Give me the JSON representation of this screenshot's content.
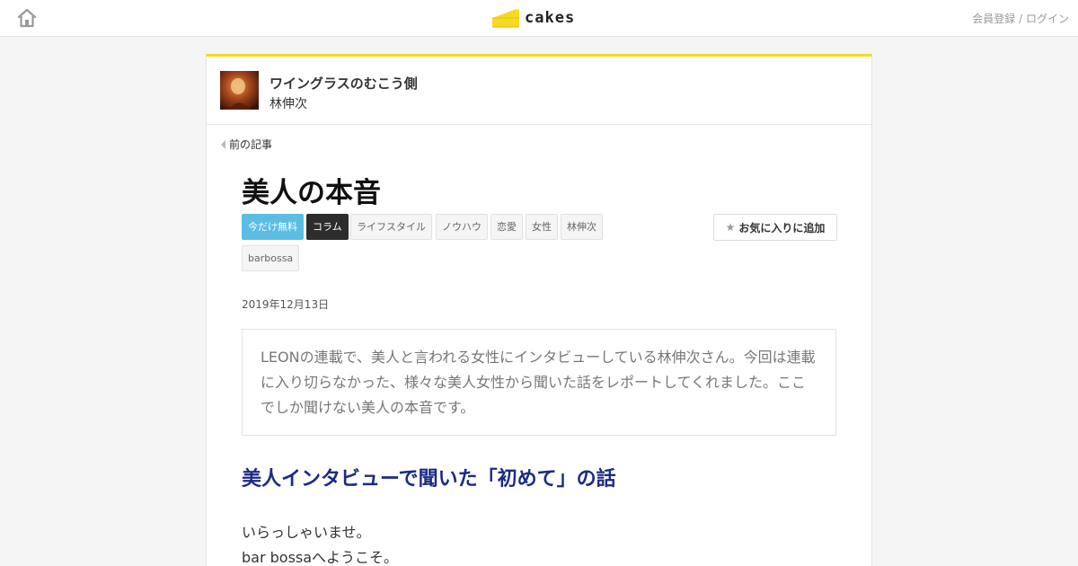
{
  "header": {
    "logo_text": "cakes",
    "auth_links": [
      "会員登録",
      "ログイン"
    ],
    "auth_separator": " / "
  },
  "series": {
    "title": "ワイングラスのむこう側",
    "author": "林伸次"
  },
  "nav": {
    "prev_label": "前の記事"
  },
  "article": {
    "title": "美人の本音",
    "tags": [
      "今だけ無料",
      "コラム",
      "ライフスタイル",
      "ノウハウ",
      "恋愛",
      "女性",
      "林伸次",
      "barbossa"
    ],
    "favorite_label": "お気に入りに追加",
    "date": "2019年12月13日",
    "lead": "LEONの連載で、美人と言われる女性にインタビューしている林伸次さん。今回は連載に入り切らなかった、様々な美人女性から聞いた話をレポートしてくれました。ここでしか聞けない美人の本音です。",
    "section_heading": "美人インタビューで聞いた「初めて」の話",
    "body_lines": [
      "いらっしゃいませ。",
      "bar bossaへようこそ。"
    ]
  },
  "colors": {
    "accent_yellow": "#f5d923",
    "tag_free": "#5bbde3",
    "tag_column": "#2d2d2d",
    "heading_blue": "#1b2a87"
  }
}
